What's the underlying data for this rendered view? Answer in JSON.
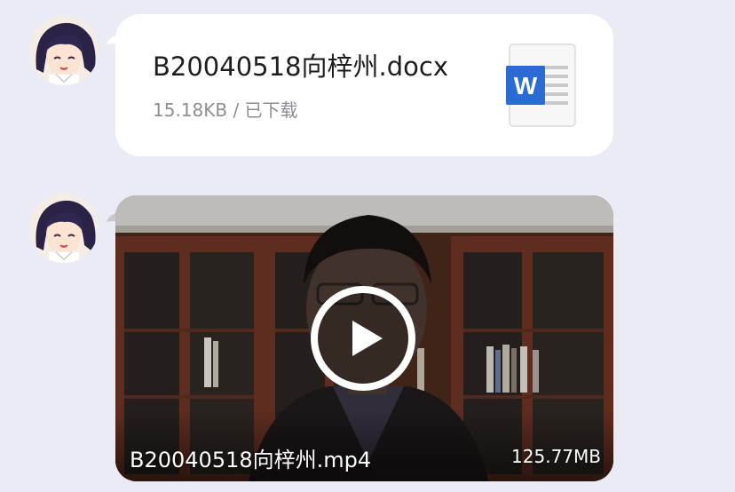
{
  "messages": [
    {
      "type": "file",
      "file_name": "B20040518向梓州.docx",
      "file_meta": "15.18KB / 已下载",
      "icon": "word-document-icon",
      "icon_letter": "W"
    },
    {
      "type": "video",
      "file_name": "B20040518向梓州.mp4",
      "file_size": "125.77MB",
      "icon": "play-icon"
    }
  ],
  "colors": {
    "background": "#ebebf5",
    "bubble": "#ffffff",
    "word_blue": "#2b6cd4",
    "meta_gray": "#8e8e93"
  }
}
